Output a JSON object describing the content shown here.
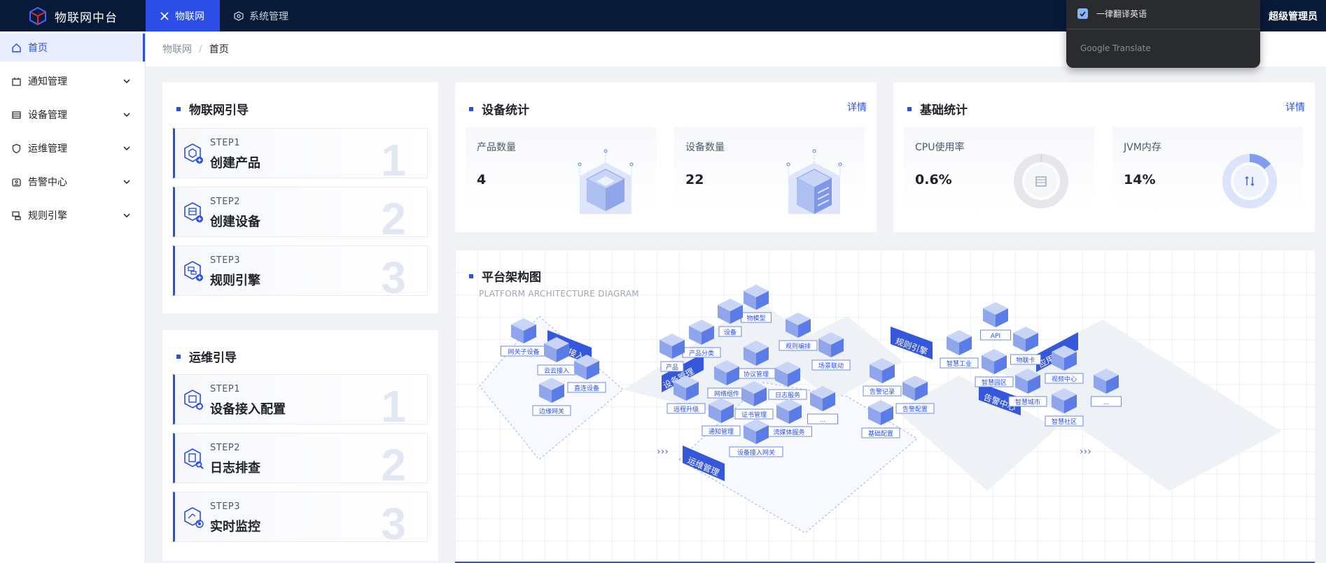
{
  "app": {
    "title": "物联网中台"
  },
  "topnav": [
    {
      "label": "物联网"
    },
    {
      "label": "系统管理"
    }
  ],
  "user": {
    "name": "超级管理员"
  },
  "translate_popup": {
    "option": "一律翻译英语",
    "brand": "Google Translate"
  },
  "sidebar": {
    "items": [
      {
        "label": "首页",
        "icon": "home-icon"
      },
      {
        "label": "通知管理",
        "icon": "notice-icon"
      },
      {
        "label": "设备管理",
        "icon": "device-icon"
      },
      {
        "label": "运维管理",
        "icon": "shield-icon"
      },
      {
        "label": "告警中心",
        "icon": "alarm-icon"
      },
      {
        "label": "规则引擎",
        "icon": "rule-icon"
      }
    ]
  },
  "breadcrumb": [
    "物联网",
    "/",
    "首页"
  ],
  "iot_guide": {
    "title": "物联网引导",
    "steps": [
      {
        "step": "STEP1",
        "name": "创建产品",
        "num": "1"
      },
      {
        "step": "STEP2",
        "name": "创建设备",
        "num": "2"
      },
      {
        "step": "STEP3",
        "name": "规则引擎",
        "num": "3"
      }
    ]
  },
  "ops_guide": {
    "title": "运维引导",
    "steps": [
      {
        "step": "STEP1",
        "name": "设备接入配置",
        "num": "1"
      },
      {
        "step": "STEP2",
        "name": "日志排查",
        "num": "2"
      },
      {
        "step": "STEP3",
        "name": "实时监控",
        "num": "3"
      }
    ]
  },
  "device_stats": {
    "title": "设备统计",
    "detail": "详情",
    "items": [
      {
        "label": "产品数量",
        "value": "4"
      },
      {
        "label": "设备数量",
        "value": "22"
      }
    ]
  },
  "basic_stats": {
    "title": "基础统计",
    "detail": "详情",
    "items": [
      {
        "label": "CPU使用率",
        "value": "0.6%",
        "fraction": 0.006
      },
      {
        "label": "JVM内存",
        "value": "14%",
        "fraction": 0.14
      }
    ]
  },
  "architecture": {
    "title": "平台架构图",
    "subtitle": "PLATFORM ARCHITECTURE DIAGRAM",
    "banners": [
      "物联接入",
      "设备管理",
      "规则引擎",
      "告警中心",
      "应用支撑",
      "运维管理"
    ],
    "labels": [
      "网关子设备",
      "云云接入",
      "直连设备",
      "边缘网关",
      "物模型",
      "设备",
      "产品分类",
      "产品",
      "规则编排",
      "场景联动",
      "协议管理",
      "网络组件",
      "日志服务",
      "远程升级",
      "证书管理",
      "...",
      "通知管理",
      "流媒体服务",
      "设备接入网关",
      "告警记录",
      "告警配置",
      "基础配置",
      "API",
      "智慧工业",
      "物联卡",
      "视频中心",
      "智慧园区",
      "智慧城市",
      "智慧社区",
      "..."
    ]
  },
  "colors": {
    "accent": "#2b4fe6",
    "topbar": "#081a37"
  }
}
